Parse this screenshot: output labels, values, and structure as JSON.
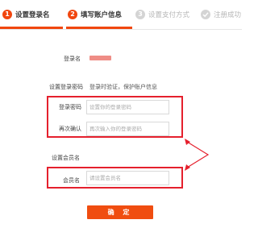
{
  "steps": [
    {
      "num": "1",
      "label": "设置登录名",
      "state": "active"
    },
    {
      "num": "2",
      "label": "填写账户信息",
      "state": "active"
    },
    {
      "num": "3",
      "label": "设置支付方式",
      "state": "inactive"
    },
    {
      "num": "",
      "label": "注册成功",
      "state": "inactive",
      "icon": "check-icon"
    }
  ],
  "form": {
    "login_name_label": "登录名",
    "login_pwd_section_label": "设置登录密码",
    "login_pwd_hint": "登录时验证，保护账户信息",
    "login_pwd_label": "登录密码",
    "login_pwd_placeholder": "设置你的登录密码",
    "confirm_pwd_label": "再次确认",
    "confirm_pwd_placeholder": "再次输入你的登录密码",
    "member_section_label": "设置会员名",
    "member_label": "会员名",
    "member_placeholder": "请设置会员名"
  },
  "confirm_button": "确 定",
  "colors": {
    "accent": "#f1460f",
    "highlight": "#e5202d",
    "redacted": "#ef8d86"
  }
}
